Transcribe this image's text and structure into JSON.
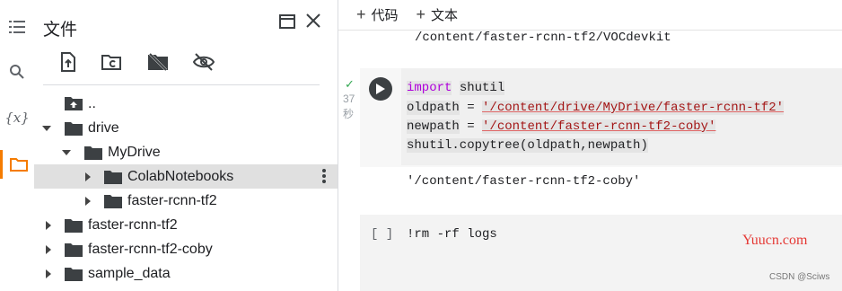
{
  "sidebar_rail": {
    "items": [
      {
        "name": "table-of-contents"
      },
      {
        "name": "search"
      },
      {
        "name": "variables",
        "label": "{x}"
      },
      {
        "name": "files",
        "active": true
      }
    ]
  },
  "file_panel": {
    "title": "文件",
    "tree": [
      {
        "label": "..",
        "icon": "folder-up-icon"
      },
      {
        "label": "drive",
        "expanded": true
      },
      {
        "label": "MyDrive",
        "expanded": true
      },
      {
        "label": "ColabNotebooks",
        "selected": true
      },
      {
        "label": "faster-rcnn-tf2"
      },
      {
        "label": "faster-rcnn-tf2"
      },
      {
        "label": "faster-rcnn-tf2-coby"
      },
      {
        "label": "sample_data"
      }
    ]
  },
  "toolbar": {
    "add_code": "代码",
    "add_text": "文本"
  },
  "notebook": {
    "prev_output": "/content/faster-rcnn-tf2/VOCdevkit",
    "cell1": {
      "status_time": "37",
      "status_unit": "秒",
      "code": {
        "line1_kw": "import",
        "line1_rest": "shutil",
        "line2_var": "oldpath",
        "line2_eq": "=",
        "line2_str": "'/content/drive/MyDrive/faster-rcnn-tf2'",
        "line3_var": "newpath",
        "line3_eq": "=",
        "line3_str": "'/content/faster-rcnn-tf2-coby'",
        "line4": "shutil.copytree(oldpath,newpath)"
      },
      "output": "'/content/faster-rcnn-tf2-coby'"
    },
    "cell2": {
      "bracket": "[ ]",
      "code": "!rm  -rf  logs"
    }
  },
  "watermarks": {
    "yuucn": "Yuucn.com",
    "csdn": "CSDN @Sciws"
  },
  "colors": {
    "accent": "#f57c00",
    "keyword": "#af00db",
    "string": "#a31515",
    "check": "#34a853"
  }
}
